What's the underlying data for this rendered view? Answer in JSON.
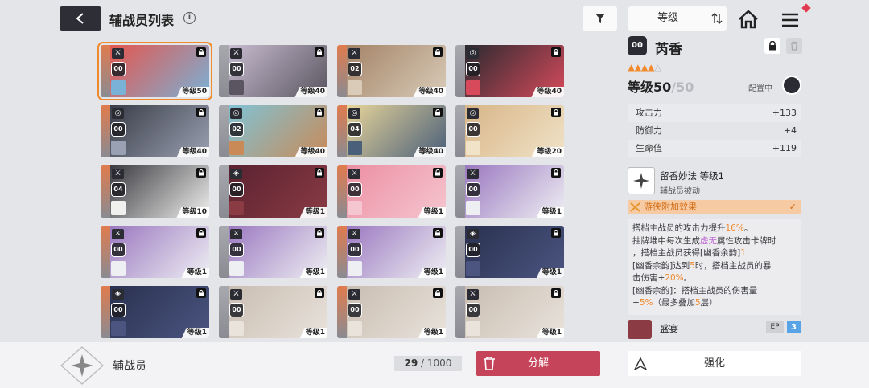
{
  "header": {
    "title": "辅战员列表",
    "info_icon": "i",
    "sort_label": "等级",
    "back_icon": "back-arrow-icon",
    "filter_icon": "filter-icon",
    "sort_dir_icon": "sort-direction-icon",
    "home_icon": "home-icon",
    "menu_icon": "menu-icon"
  },
  "cards": [
    {
      "badge": "⚔",
      "num": "00",
      "level": "等级50",
      "selected": true,
      "palette": [
        "#e5564e",
        "#7ab1d6"
      ]
    },
    {
      "badge": "⚔",
      "num": "00",
      "level": "等级40",
      "palette": [
        "#c7bcd0",
        "#5a5560"
      ]
    },
    {
      "badge": "⚔",
      "num": "02",
      "level": "等级40",
      "palette": [
        "#a48468",
        "#d9cbb8"
      ]
    },
    {
      "badge": "◎",
      "num": "00",
      "level": "等级40",
      "palette": [
        "#2b2a30",
        "#d64a5b"
      ]
    },
    {
      "badge": "◎",
      "num": "00",
      "level": "等级40",
      "palette": [
        "#3a3d48",
        "#9aa1b2"
      ]
    },
    {
      "badge": "◎",
      "num": "02",
      "level": "等级40",
      "palette": [
        "#7fc3d6",
        "#c98a58"
      ]
    },
    {
      "badge": "◎",
      "num": "04",
      "level": "等级40",
      "palette": [
        "#e8d59a",
        "#4a5f7a"
      ]
    },
    {
      "badge": "◎",
      "num": "00",
      "level": "等级20",
      "palette": [
        "#d8b587",
        "#f0e3c8"
      ]
    },
    {
      "badge": "⚔",
      "num": "04",
      "level": "等级10",
      "palette": [
        "#3b3a40",
        "#f0f0ee"
      ]
    },
    {
      "badge": "◈",
      "num": "00",
      "level": "等级1",
      "palette": [
        "#5a2230",
        "#8a3b44"
      ]
    },
    {
      "badge": "⚔",
      "num": "00",
      "level": "等级1",
      "palette": [
        "#ec8fa3",
        "#f5c6cf"
      ]
    },
    {
      "badge": "⚔",
      "num": "00",
      "level": "等级1",
      "palette": [
        "#9b78c0",
        "#eeeff3"
      ]
    },
    {
      "badge": "⚔",
      "num": "00",
      "level": "等级1",
      "palette": [
        "#9b78c0",
        "#eeeff3"
      ]
    },
    {
      "badge": "⚔",
      "num": "00",
      "level": "等级1",
      "palette": [
        "#9b78c0",
        "#eeeff3"
      ]
    },
    {
      "badge": "⚔",
      "num": "00",
      "level": "等级1",
      "palette": [
        "#9b78c0",
        "#eeeff3"
      ]
    },
    {
      "badge": "◈",
      "num": "00",
      "level": "等级1",
      "palette": [
        "#2a3150",
        "#4b5580"
      ]
    },
    {
      "badge": "◈",
      "num": "00",
      "level": "等级1",
      "palette": [
        "#2a3150",
        "#4b5580"
      ]
    },
    {
      "badge": "⚔",
      "num": "00",
      "level": "等级1",
      "palette": [
        "#c9bdb1",
        "#e9e3dc"
      ]
    },
    {
      "badge": "⚔",
      "num": "00",
      "level": "等级1",
      "palette": [
        "#c9bdb1",
        "#e9e3dc"
      ]
    },
    {
      "badge": "⚔",
      "num": "00",
      "level": "等级1",
      "palette": [
        "#c9bdb1",
        "#e9e3dc"
      ]
    }
  ],
  "panel": {
    "num": "00",
    "name": "芮香",
    "stars_filled": "▲▲▲▲",
    "stars_empty": "△",
    "level_label": "等级50",
    "level_max": "/50",
    "equipped_label": "配置中",
    "stats": [
      {
        "label": "攻击力",
        "value": "+133"
      },
      {
        "label": "防御力",
        "value": "+4"
      },
      {
        "label": "生命值",
        "value": "+119"
      }
    ],
    "skill_name": "留香妙法 等级1",
    "skill_type": "辅战员被动",
    "bonus_label": "游侠附加效果",
    "bonus_check": "✓",
    "desc": {
      "l1a": "搭档主战员的攻击力提升",
      "l1b": "16%",
      "l1c": "。",
      "l2a": "抽牌堆中每次生成",
      "l2b": "虚无",
      "l2c": "属性攻击卡牌时",
      "l3a": "，搭档主战员获得[幽香余韵]",
      "l3b": "1",
      "l4a": "[幽香余韵]达到",
      "l4b": "5",
      "l4c": "时，搭档主战员的暴",
      "l5a": "击伤害+",
      "l5b": "20%",
      "l5c": "。",
      "l6": "[幽香余韵]：搭档主战员的伤害量",
      "l7a": "+",
      "l7b": "5%",
      "l7c": "（最多叠加",
      "l7d": "5",
      "l7e": "层）"
    },
    "feast_name": "盛宴",
    "ep_label": "EP",
    "ep_value": "3"
  },
  "footer": {
    "title": "辅战员",
    "count_current": "29",
    "count_total": " / 1000",
    "dismantle_label": "分解",
    "enhance_label": "强化"
  }
}
